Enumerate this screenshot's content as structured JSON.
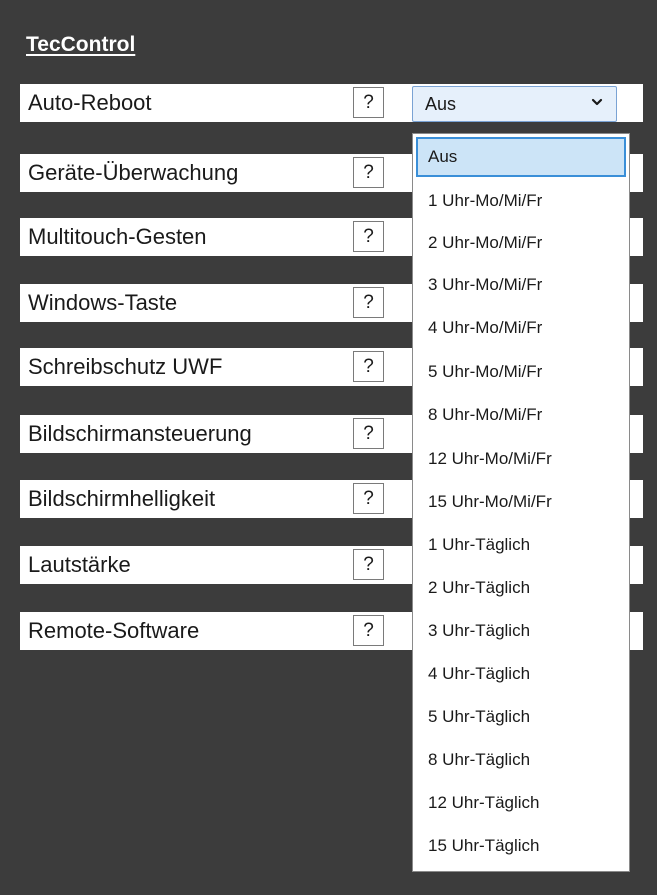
{
  "title": "TecControl",
  "help_label": "?",
  "settings": [
    "Auto-Reboot",
    "Geräte-Überwachung",
    "Multitouch-Gesten",
    "Windows-Taste",
    "Schreibschutz UWF",
    "Bildschirmansteuerung",
    "Bildschirmhelligkeit",
    "Lautstärke",
    "Remote-Software"
  ],
  "auto_reboot_select": {
    "value": "Aus",
    "options": [
      "Aus",
      "1 Uhr-Mo/Mi/Fr",
      "2 Uhr-Mo/Mi/Fr",
      "3 Uhr-Mo/Mi/Fr",
      "4 Uhr-Mo/Mi/Fr",
      "5 Uhr-Mo/Mi/Fr",
      "8 Uhr-Mo/Mi/Fr",
      "12 Uhr-Mo/Mi/Fr",
      "15 Uhr-Mo/Mi/Fr",
      "1 Uhr-Täglich",
      "2 Uhr-Täglich",
      "3 Uhr-Täglich",
      "4 Uhr-Täglich",
      "5 Uhr-Täglich",
      "8 Uhr-Täglich",
      "12 Uhr-Täglich",
      "15 Uhr-Täglich"
    ],
    "highlighted_option": "Aus"
  },
  "icons": {
    "dropdown": "chevron-down-icon"
  },
  "colors": {
    "background": "#3c3c3c",
    "highlight": "#cce4f7",
    "highlight_border": "#3a8fd8"
  }
}
